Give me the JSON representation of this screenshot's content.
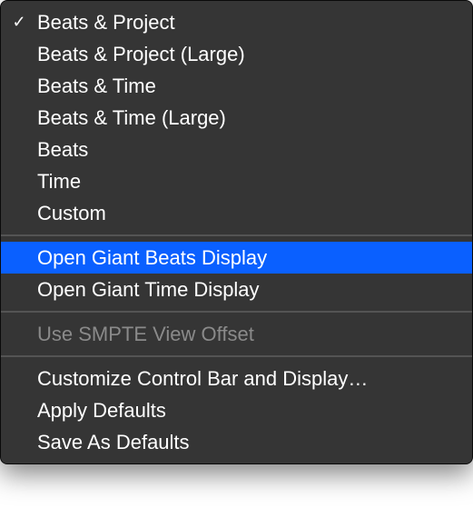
{
  "menu": {
    "groups": [
      {
        "items": [
          {
            "label": "Beats & Project",
            "checked": true,
            "enabled": true,
            "highlighted": false,
            "name": "menu-item-beats-project"
          },
          {
            "label": "Beats & Project (Large)",
            "checked": false,
            "enabled": true,
            "highlighted": false,
            "name": "menu-item-beats-project-large"
          },
          {
            "label": "Beats & Time",
            "checked": false,
            "enabled": true,
            "highlighted": false,
            "name": "menu-item-beats-time"
          },
          {
            "label": "Beats & Time (Large)",
            "checked": false,
            "enabled": true,
            "highlighted": false,
            "name": "menu-item-beats-time-large"
          },
          {
            "label": "Beats",
            "checked": false,
            "enabled": true,
            "highlighted": false,
            "name": "menu-item-beats"
          },
          {
            "label": "Time",
            "checked": false,
            "enabled": true,
            "highlighted": false,
            "name": "menu-item-time"
          },
          {
            "label": "Custom",
            "checked": false,
            "enabled": true,
            "highlighted": false,
            "name": "menu-item-custom"
          }
        ]
      },
      {
        "items": [
          {
            "label": "Open Giant Beats Display",
            "checked": false,
            "enabled": true,
            "highlighted": true,
            "name": "menu-item-open-giant-beats-display"
          },
          {
            "label": "Open Giant Time Display",
            "checked": false,
            "enabled": true,
            "highlighted": false,
            "name": "menu-item-open-giant-time-display"
          }
        ]
      },
      {
        "items": [
          {
            "label": "Use SMPTE View Offset",
            "checked": false,
            "enabled": false,
            "highlighted": false,
            "name": "menu-item-use-smpte-view-offset"
          }
        ]
      },
      {
        "items": [
          {
            "label": "Customize Control Bar and Display…",
            "checked": false,
            "enabled": true,
            "highlighted": false,
            "name": "menu-item-customize-control-bar"
          },
          {
            "label": "Apply Defaults",
            "checked": false,
            "enabled": true,
            "highlighted": false,
            "name": "menu-item-apply-defaults"
          },
          {
            "label": "Save As Defaults",
            "checked": false,
            "enabled": true,
            "highlighted": false,
            "name": "menu-item-save-as-defaults"
          }
        ]
      }
    ]
  },
  "checkmark_glyph": "✓"
}
